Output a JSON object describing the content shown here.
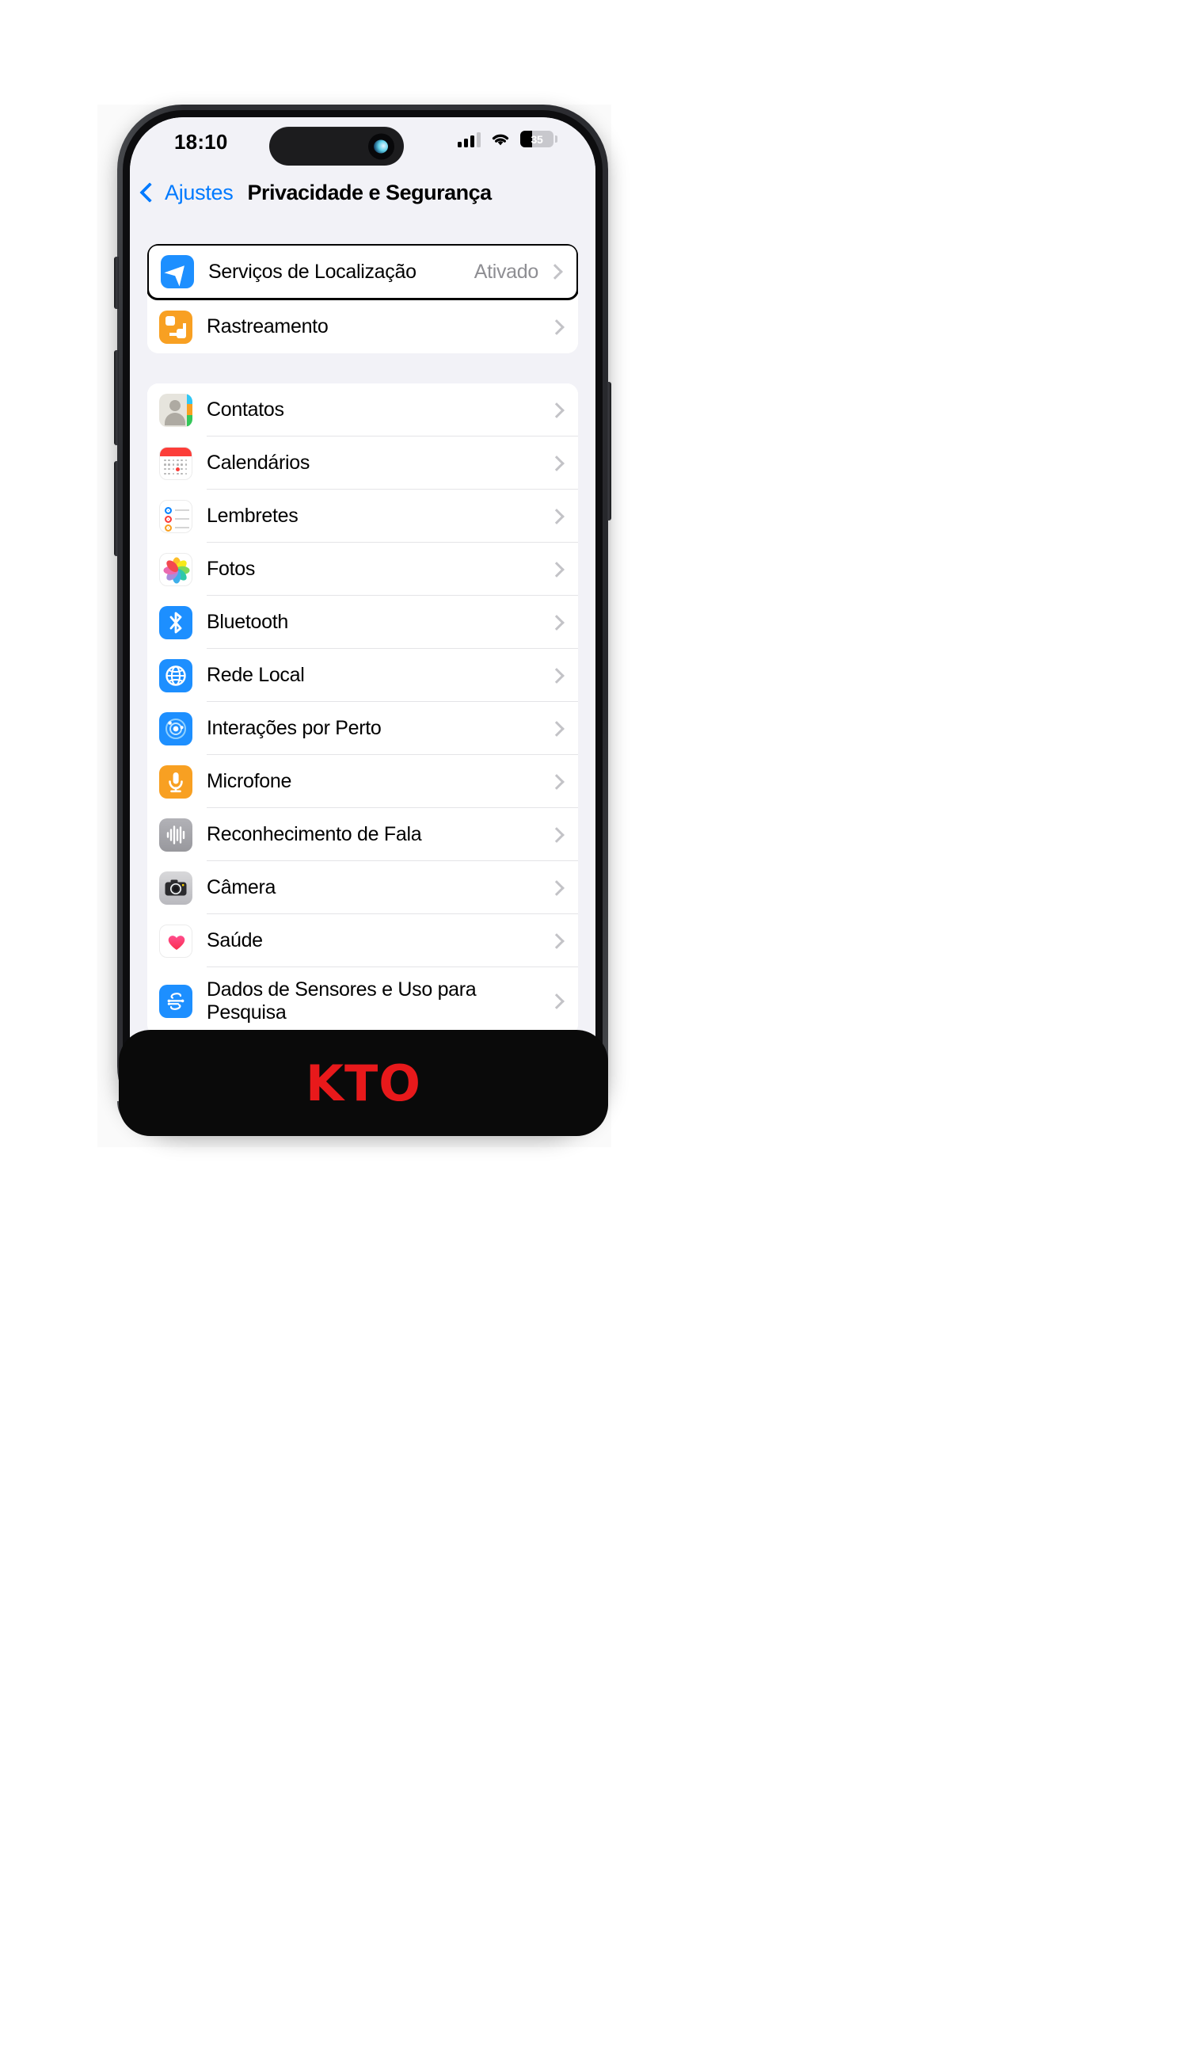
{
  "status_bar": {
    "time": "18:10",
    "battery_percent": "35",
    "battery_level": 35,
    "cellular_icon": "cellular-signal-icon",
    "wifi_icon": "wifi-icon",
    "battery_icon": "battery-icon"
  },
  "nav": {
    "back_label": "Ajustes",
    "back_icon": "chevron-left-icon",
    "title": "Privacidade e Segurança"
  },
  "cards": [
    {
      "id": "top",
      "rows": [
        {
          "label": "Serviços de Localização",
          "value": "Ativado",
          "icon": "location-arrow-icon",
          "highlighted": true
        },
        {
          "label": "Rastreamento",
          "value": "",
          "icon": "tracking-icon",
          "highlighted": false
        }
      ]
    },
    {
      "id": "main",
      "rows": [
        {
          "label": "Contatos",
          "value": "",
          "icon": "contacts-icon"
        },
        {
          "label": "Calendários",
          "value": "",
          "icon": "calendar-icon"
        },
        {
          "label": "Lembretes",
          "value": "",
          "icon": "reminders-icon"
        },
        {
          "label": "Fotos",
          "value": "",
          "icon": "photos-icon"
        },
        {
          "label": "Bluetooth",
          "value": "",
          "icon": "bluetooth-icon"
        },
        {
          "label": "Rede Local",
          "value": "",
          "icon": "local-network-globe-icon"
        },
        {
          "label": "Interações por Perto",
          "value": "",
          "icon": "nearby-interactions-icon"
        },
        {
          "label": "Microfone",
          "value": "",
          "icon": "microphone-icon"
        },
        {
          "label": "Reconhecimento de Fala",
          "value": "",
          "icon": "speech-waveform-icon"
        },
        {
          "label": "Câmera",
          "value": "",
          "icon": "camera-icon"
        },
        {
          "label": "Saúde",
          "value": "",
          "icon": "health-heart-icon"
        },
        {
          "label": "Dados de Sensores e Uso para Pesquisa",
          "value": "",
          "icon": "sensor-research-icon"
        }
      ]
    }
  ],
  "overlay": {
    "brand": "KTO",
    "brand_color": "#e8191b",
    "background_color": "#0a0a0a"
  },
  "colors": {
    "accent_blue": "#007aff",
    "icon_blue": "#1d8fff",
    "icon_orange": "#f8a022",
    "value_gray": "#8e8e93",
    "screen_bg": "#f2f2f7"
  }
}
